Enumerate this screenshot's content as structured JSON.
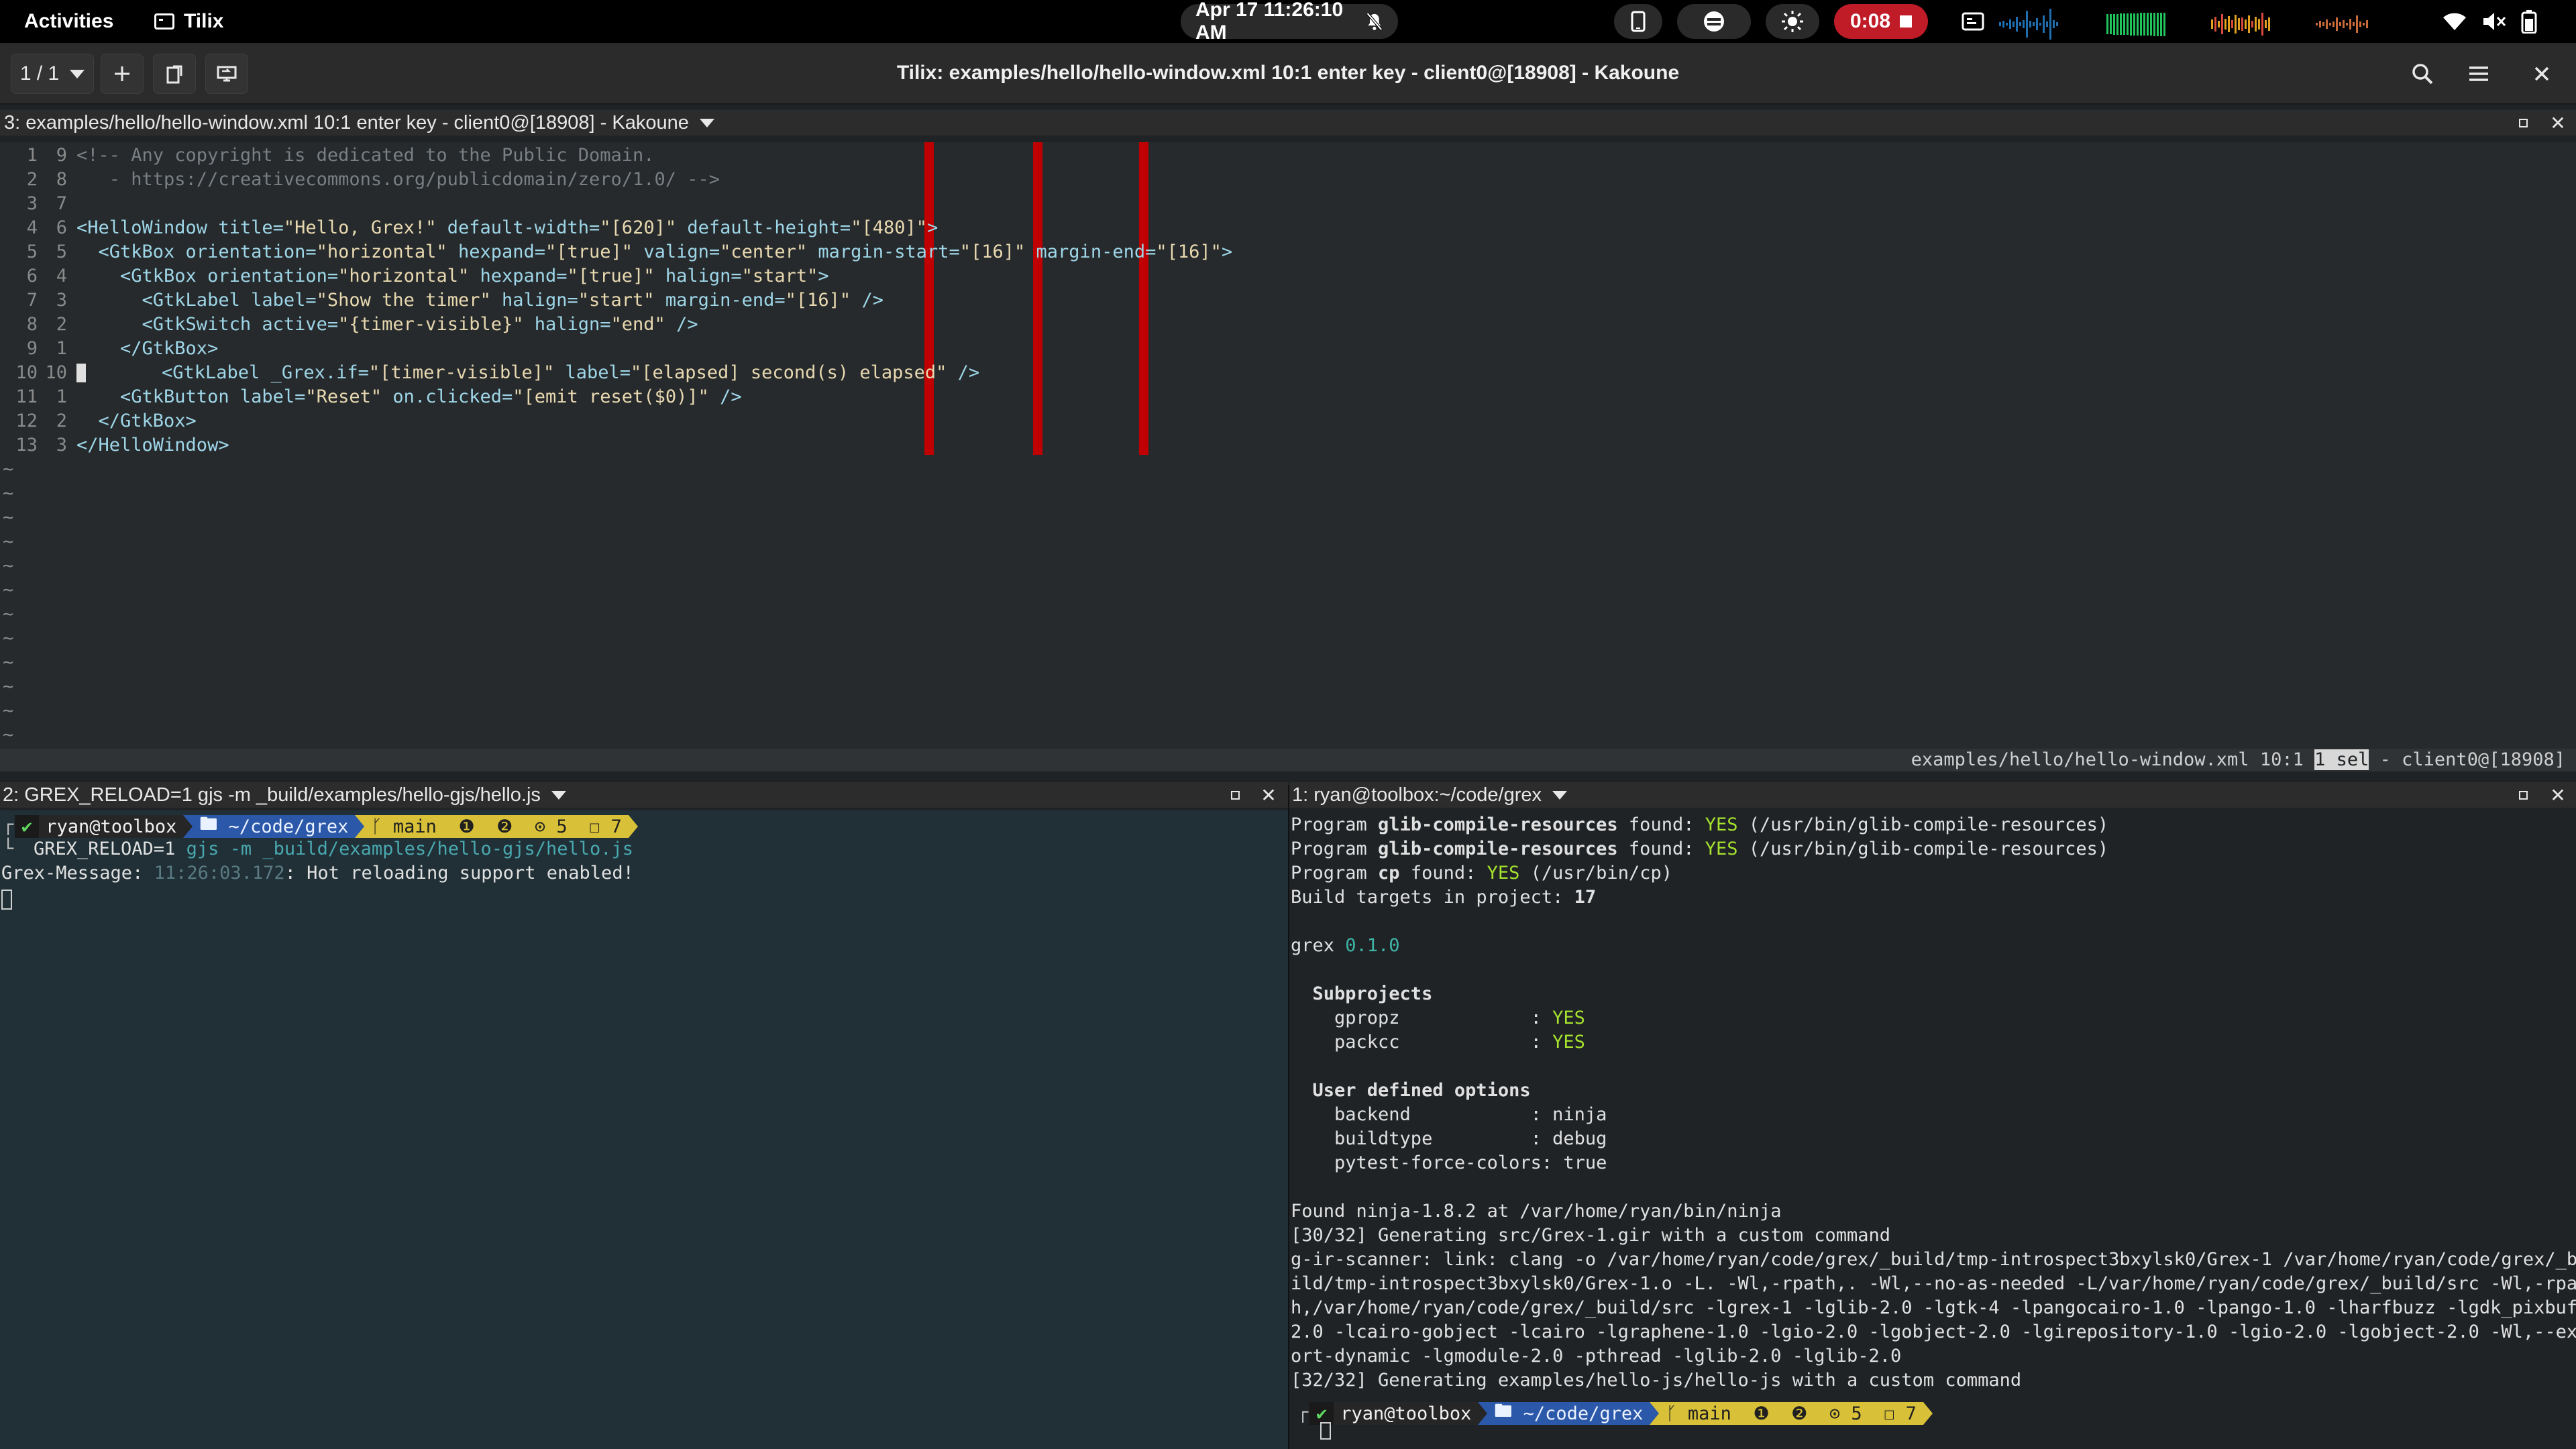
{
  "topbar": {
    "activities": "Activities",
    "app_name": "Tilix",
    "clock": "Apr 17  11:26:10 AM",
    "recording_time": "0:08",
    "icons": [
      "tilix-icon",
      "dnd-bell-off-icon",
      "phone-icon",
      "privacy-indicator-icon",
      "brightness-icon",
      "record-stop-icon",
      "screen-share-icon",
      "cpu-graph-icon",
      "memory-graph-icon",
      "network-graph-icon",
      "disk-graph-icon",
      "wifi-icon",
      "volume-muted-icon",
      "battery-icon"
    ]
  },
  "header": {
    "session_counter": "1 / 1",
    "window_title": "Tilix: examples/hello/hello-window.xml 10:1  enter key - client0@[18908] - Kakoune",
    "icons": [
      "add-icon",
      "detach-icon",
      "sync-input-icon",
      "search-icon",
      "menu-icon",
      "close-icon"
    ]
  },
  "editor_pane": {
    "title": "3: examples/hello/hello-window.xml 10:1  enter key - client0@[18908] - Kakoune",
    "lines": [
      {
        "n": "1",
        "r": "9",
        "segs": [
          {
            "c": "com",
            "t": "<!-- Any copyright is dedicated to the Public Domain."
          }
        ]
      },
      {
        "n": "2",
        "r": "8",
        "segs": [
          {
            "c": "com",
            "t": "   - https://creativecommons.org/publicdomain/zero/1.0/ -->"
          }
        ]
      },
      {
        "n": "3",
        "r": "7",
        "segs": []
      },
      {
        "n": "4",
        "r": "6",
        "segs": [
          {
            "c": "tag",
            "t": "<HelloWindow "
          },
          {
            "c": "tag",
            "t": "title="
          },
          {
            "c": "str",
            "t": "\"Hello, Grex!\""
          },
          {
            "c": "tag",
            "t": " default-width="
          },
          {
            "c": "str",
            "t": "\"[620]\""
          },
          {
            "c": "tag",
            "t": " default-height="
          },
          {
            "c": "str",
            "t": "\"[480]\""
          },
          {
            "c": "tag",
            "t": ">"
          }
        ]
      },
      {
        "n": "5",
        "r": "5",
        "segs": [
          {
            "c": "tag",
            "t": "  <GtkBox orientation="
          },
          {
            "c": "str",
            "t": "\"horizontal\""
          },
          {
            "c": "tag",
            "t": " hexpand="
          },
          {
            "c": "str",
            "t": "\"[true]\""
          },
          {
            "c": "tag",
            "t": " valign="
          },
          {
            "c": "str",
            "t": "\"center\""
          },
          {
            "c": "tag",
            "t": " margin-start="
          },
          {
            "c": "str",
            "t": "\"[16]\""
          },
          {
            "c": "tag",
            "t": " margin-end="
          },
          {
            "c": "str",
            "t": "\"[16]\""
          },
          {
            "c": "tag",
            "t": ">"
          }
        ]
      },
      {
        "n": "6",
        "r": "4",
        "segs": [
          {
            "c": "tag",
            "t": "    <GtkBox orientation="
          },
          {
            "c": "str",
            "t": "\"horizontal\""
          },
          {
            "c": "tag",
            "t": " hexpand="
          },
          {
            "c": "str",
            "t": "\"[true]\""
          },
          {
            "c": "tag",
            "t": " halign="
          },
          {
            "c": "str",
            "t": "\"start\""
          },
          {
            "c": "tag",
            "t": ">"
          }
        ]
      },
      {
        "n": "7",
        "r": "3",
        "segs": [
          {
            "c": "tag",
            "t": "      <GtkLabel label="
          },
          {
            "c": "str",
            "t": "\"Show the timer\""
          },
          {
            "c": "tag",
            "t": " halign="
          },
          {
            "c": "str",
            "t": "\"start\""
          },
          {
            "c": "tag",
            "t": " margin-end="
          },
          {
            "c": "str",
            "t": "\"[16]\""
          },
          {
            "c": "tag",
            "t": " />"
          }
        ]
      },
      {
        "n": "8",
        "r": "2",
        "segs": [
          {
            "c": "tag",
            "t": "      <GtkSwitch active="
          },
          {
            "c": "str",
            "t": "\"{timer-visible}\""
          },
          {
            "c": "tag",
            "t": " halign="
          },
          {
            "c": "str",
            "t": "\"end\""
          },
          {
            "c": "tag",
            "t": " />"
          }
        ]
      },
      {
        "n": "9",
        "r": "1",
        "segs": [
          {
            "c": "tag",
            "t": "    </GtkBox>"
          }
        ]
      },
      {
        "n": "10",
        "r": "10",
        "segs": [
          {
            "c": "tag",
            "t": "    <GtkLabel _Grex.if="
          },
          {
            "c": "str",
            "t": "\"[timer-visible]\""
          },
          {
            "c": "tag",
            "t": " label="
          },
          {
            "c": "str",
            "t": "\"[elapsed] second(s) elapsed\""
          },
          {
            "c": "tag",
            "t": " />"
          }
        ]
      },
      {
        "n": "11",
        "r": "1",
        "segs": [
          {
            "c": "tag",
            "t": "    <GtkButton label="
          },
          {
            "c": "str",
            "t": "\"Reset\""
          },
          {
            "c": "tag",
            "t": " on.clicked="
          },
          {
            "c": "str",
            "t": "\"[emit reset($0)]\""
          },
          {
            "c": "tag",
            "t": " />"
          }
        ]
      },
      {
        "n": "12",
        "r": "2",
        "segs": [
          {
            "c": "tag",
            "t": "  </GtkBox>"
          }
        ]
      },
      {
        "n": "13",
        "r": "3",
        "segs": [
          {
            "c": "tag",
            "t": "</HelloWindow>"
          }
        ]
      }
    ],
    "tilde_count": 12,
    "tilde": "~",
    "status_file": "examples/hello/hello-window.xml 10:1 ",
    "status_sel": "1 sel",
    "status_client": " - client0@[18908]"
  },
  "left_pane": {
    "title": "2: GREX_RELOAD=1 gjs -m _build/examples/hello-gjs/hello.js",
    "prompt": {
      "ok": "✔",
      "user": "ryan@toolbox",
      "dir": "~/code/grex",
      "branch": "main",
      "git_info": "❶  ❷  ⊙ 5  ☐ 7"
    },
    "cmd_env": "GREX_RELOAD=1 ",
    "cmd_text": "gjs -m _build/examples/hello-gjs/hello.js",
    "msg_prefix": "Grex-Message: ",
    "msg_time": "11:26:03.172",
    "msg_text": ": Hot reloading support enabled!"
  },
  "right_pane": {
    "title": "1: ryan@toolbox:~/code/grex",
    "lines": [
      [
        {
          "t": "Program "
        },
        {
          "t": "glib-compile-resources",
          "c": "b"
        },
        {
          "t": " found: "
        },
        {
          "t": "YES",
          "c": "yes"
        },
        {
          "t": " (/usr/bin/glib-compile-resources)"
        }
      ],
      [
        {
          "t": "Program "
        },
        {
          "t": "glib-compile-resources",
          "c": "b"
        },
        {
          "t": " found: "
        },
        {
          "t": "YES",
          "c": "yes"
        },
        {
          "t": " (/usr/bin/glib-compile-resources)"
        }
      ],
      [
        {
          "t": "Program "
        },
        {
          "t": "cp",
          "c": "b"
        },
        {
          "t": " found: "
        },
        {
          "t": "YES",
          "c": "yes"
        },
        {
          "t": " (/usr/bin/cp)"
        }
      ],
      [
        {
          "t": "Build targets in project: "
        },
        {
          "t": "17",
          "c": "b"
        }
      ],
      [],
      [
        {
          "t": "grex "
        },
        {
          "t": "0.1.0",
          "c": "ver"
        }
      ],
      [],
      [
        {
          "t": "  Subprojects",
          "c": "b"
        }
      ],
      [
        {
          "t": "    gpropz            : "
        },
        {
          "t": "YES",
          "c": "yes"
        }
      ],
      [
        {
          "t": "    packcc            : "
        },
        {
          "t": "YES",
          "c": "yes"
        }
      ],
      [],
      [
        {
          "t": "  User defined options",
          "c": "b"
        }
      ],
      [
        {
          "t": "    backend           : ninja"
        }
      ],
      [
        {
          "t": "    buildtype         : debug"
        }
      ],
      [
        {
          "t": "    pytest-force-colors: true"
        }
      ],
      [],
      [
        {
          "t": "Found ninja-1.8.2 at /var/home/ryan/bin/ninja"
        }
      ],
      [
        {
          "t": "[30/32] Generating src/Grex-1.gir with a custom command"
        }
      ],
      [
        {
          "t": "g-ir-scanner: link: clang -o /var/home/ryan/code/grex/_build/tmp-introspect3bxylsk0/Grex-1 /var/home/ryan/code/grex/_bu"
        }
      ],
      [
        {
          "t": "ild/tmp-introspect3bxylsk0/Grex-1.o -L. -Wl,-rpath,. -Wl,--no-as-needed -L/var/home/ryan/code/grex/_build/src -Wl,-rpat"
        }
      ],
      [
        {
          "t": "h,/var/home/ryan/code/grex/_build/src -lgrex-1 -lglib-2.0 -lgtk-4 -lpangocairo-1.0 -lpango-1.0 -lharfbuzz -lgdk_pixbuf-"
        }
      ],
      [
        {
          "t": "2.0 -lcairo-gobject -lcairo -lgraphene-1.0 -lgio-2.0 -lgobject-2.0 -lgirepository-1.0 -lgio-2.0 -lgobject-2.0 -Wl,--exp"
        }
      ],
      [
        {
          "t": "ort-dynamic -lgmodule-2.0 -pthread -lglib-2.0 -lglib-2.0"
        }
      ],
      [
        {
          "t": "[32/32] Generating examples/hello-js/hello-js with a custom command"
        }
      ]
    ],
    "prompt": {
      "ok": "✔",
      "user": "ryan@toolbox",
      "dir": "~/code/grex",
      "branch": "main",
      "git_info": "❶  ❷  ⊙ 5  ☐ 7"
    }
  }
}
